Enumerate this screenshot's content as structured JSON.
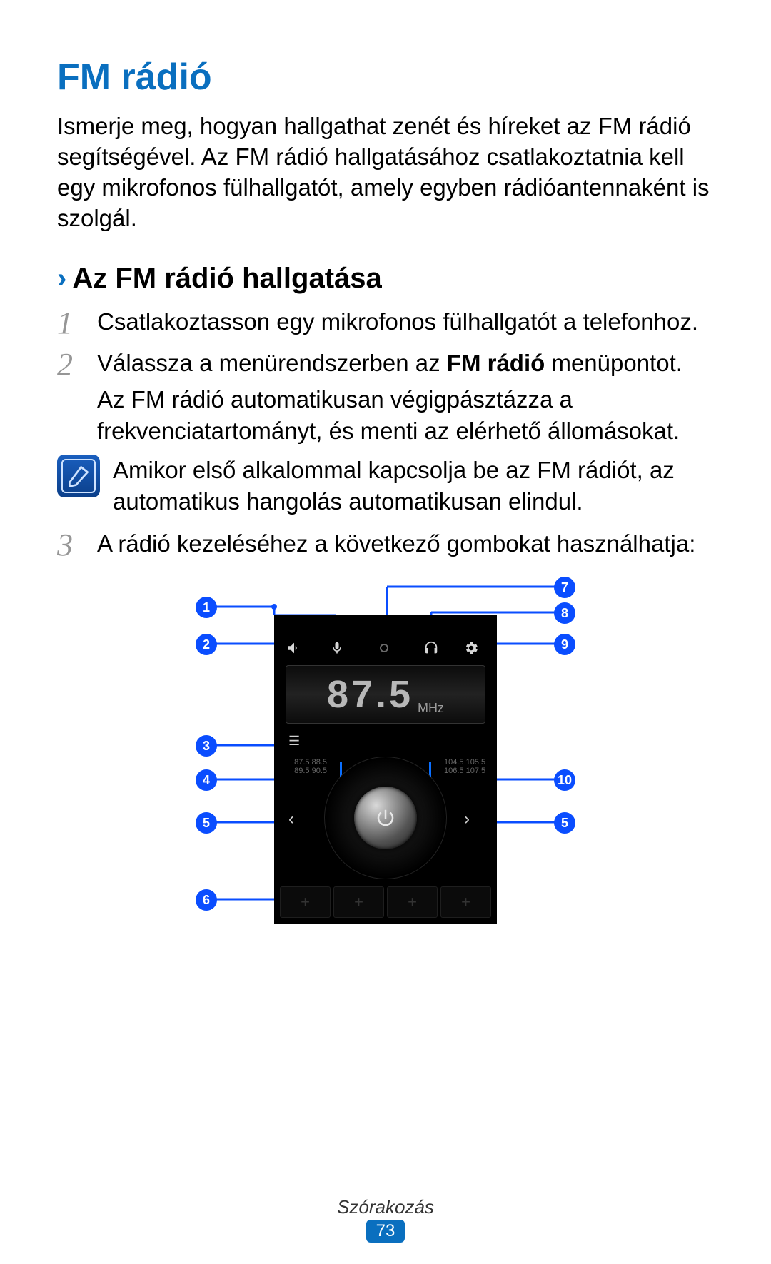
{
  "title": "FM rádió",
  "intro": "Ismerje meg, hogyan hallgathat zenét és híreket az FM rádió segítségével. Az FM rádió hallgatásához csatlakoztatnia kell egy mikrofonos fülhallgatót, amely egyben rádióantennaként is szolgál.",
  "sub_heading": "Az FM rádió hallgatása",
  "steps": [
    {
      "num": "1",
      "body": "Csatlakoztasson egy mikrofonos fülhallgatót a telefonhoz."
    },
    {
      "num": "2",
      "body": "Válassza a menürendszerben az ",
      "bold": "FM rádió",
      "body_after": " menüpontot.",
      "second": "Az FM rádió automatikusan végigpásztázza a frekvenciatartományt, és menti az elérhető állomásokat."
    },
    {
      "num": "3",
      "body": "A rádió kezeléséhez a következő gombokat használhatja:"
    }
  ],
  "note": "Amikor első alkalommal kapcsolja be az FM rádiót, az automatikus hangolás automatikusan elindul.",
  "radio": {
    "frequency": "87.5",
    "unit": "MHz",
    "scale_left": "87.5\n88.5\n89.5\n90.5",
    "scale_right": "104.5\n105.5\n106.5\n107.5",
    "preset_glyph": "+"
  },
  "callout_labels": [
    "1",
    "2",
    "3",
    "4",
    "5",
    "6",
    "7",
    "8",
    "9",
    "10"
  ],
  "footer": {
    "section": "Szórakozás",
    "page": "73"
  }
}
